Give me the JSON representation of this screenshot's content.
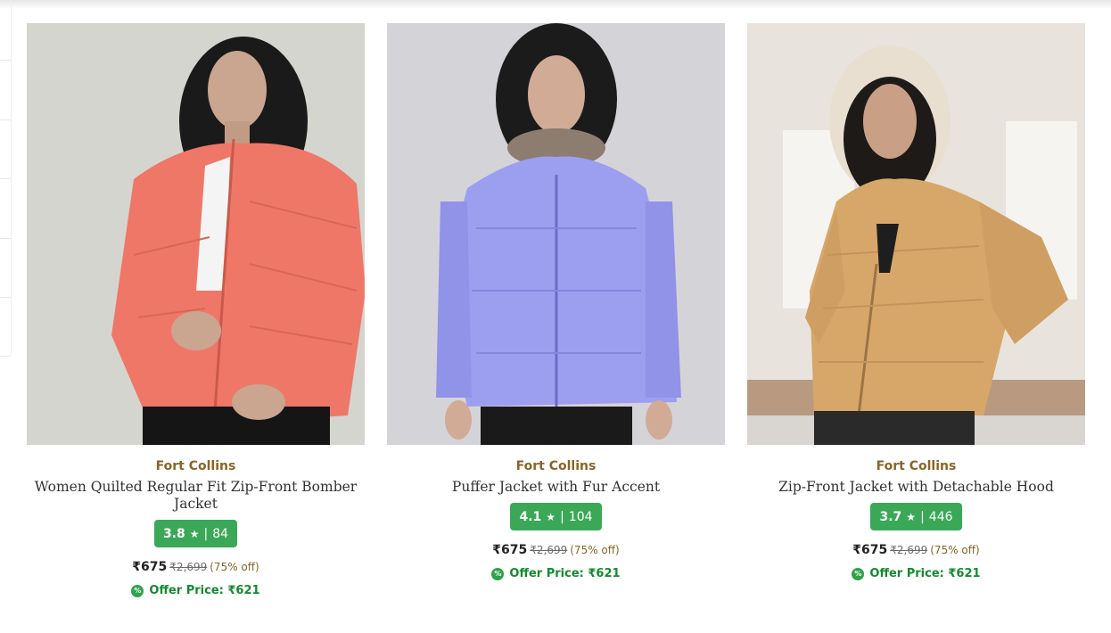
{
  "products": [
    {
      "brand": "Fort Collins",
      "title": "Women Quilted Regular Fit Zip-Front Bomber Jacket",
      "rating": "3.8",
      "star": "★",
      "separator": "|",
      "reviews": "84",
      "price": "₹675",
      "mrp": "₹2,699",
      "discount": "(75% off)",
      "offer_icon": "%",
      "offer": "Offer Price: ₹621",
      "image": {
        "background": "#d7d7d1",
        "jacket_color": "#ef7767",
        "icon": "product-photo"
      }
    },
    {
      "brand": "Fort Collins",
      "title": "Puffer Jacket with Fur Accent",
      "rating": "4.1",
      "star": "★",
      "separator": "|",
      "reviews": "104",
      "price": "₹675",
      "mrp": "₹2,699",
      "discount": "(75% off)",
      "offer_icon": "%",
      "offer": "Offer Price: ₹621",
      "image": {
        "background": "#d4d4d8",
        "jacket_color": "#9c9ef0",
        "icon": "product-photo"
      }
    },
    {
      "brand": "Fort Collins",
      "title": "Zip-Front Jacket with Detachable Hood",
      "rating": "3.7",
      "star": "★",
      "separator": "|",
      "reviews": "446",
      "price": "₹675",
      "mrp": "₹2,699",
      "discount": "(75% off)",
      "offer_icon": "%",
      "offer": "Offer Price: ₹621",
      "image": {
        "background": "#e8e3dc",
        "jacket_color": "#d7a76a",
        "icon": "product-photo"
      }
    }
  ],
  "colors": {
    "brand_text": "#8a6428",
    "rating_badge": "#3aa856",
    "offer_text": "#138a2f"
  }
}
